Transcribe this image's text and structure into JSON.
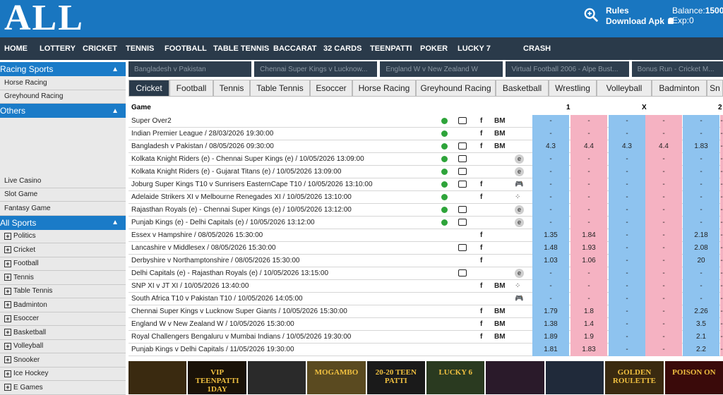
{
  "header": {
    "logo": "ALL",
    "rules": "Rules",
    "download": "Download Apk",
    "balance_label": "Balance:",
    "balance_value": "1500",
    "exp_label": "Exp:",
    "exp_value": "0"
  },
  "nav": [
    "HOME",
    "LOTTERY",
    "CRICKET",
    "TENNIS",
    "FOOTBALL",
    "TABLE TENNIS",
    "BACCARAT",
    "32 CARDS",
    "TEENPATTI",
    "POKER",
    "LUCKY 7",
    "CRASH"
  ],
  "sidebar": {
    "racing_title": "Racing Sports",
    "racing_items": [
      "Horse Racing",
      "Greyhound Racing"
    ],
    "others_title": "Others",
    "others_items": [
      "Live Casino",
      "Slot Game",
      "Fantasy Game"
    ],
    "all_title": "All Sports",
    "all_items": [
      "Politics",
      "Cricket",
      "Football",
      "Tennis",
      "Table Tennis",
      "Badminton",
      "Esoccer",
      "Basketball",
      "Volleyball",
      "Snooker",
      "Ice Hockey",
      "E Games"
    ]
  },
  "tickers": [
    "Bangladesh v Pakistan",
    "Chennai Super Kings v Lucknow...",
    "England W v New Zealand W",
    "Virtual Football 2006 - Alpe Bust...",
    "Bonus Run - Cricket M..."
  ],
  "tabs": [
    "Cricket",
    "Football",
    "Tennis",
    "Table Tennis",
    "Esoccer",
    "Horse Racing",
    "Greyhound Racing",
    "Basketball",
    "Wrestling",
    "Volleyball",
    "Badminton",
    "Sn"
  ],
  "table": {
    "col_game": "Game",
    "col_1": "1",
    "col_x": "X",
    "col_2": "2",
    "rows": [
      {
        "name": "Super Over2",
        "live": true,
        "tv": true,
        "f": true,
        "bm": true,
        "e": false,
        "icon": "",
        "odds": [
          "-",
          "-",
          "-",
          "-",
          "-",
          "-"
        ]
      },
      {
        "name": "Indian Premier League / 28/03/2026 19:30:00",
        "live": true,
        "tv": false,
        "f": true,
        "bm": true,
        "e": false,
        "icon": "",
        "odds": [
          "-",
          "-",
          "-",
          "-",
          "-",
          "-"
        ]
      },
      {
        "name": "Bangladesh v Pakistan / 08/05/2026 09:30:00",
        "live": true,
        "tv": true,
        "f": true,
        "bm": true,
        "e": false,
        "icon": "",
        "odds": [
          "4.3",
          "4.4",
          "4.3",
          "4.4",
          "1.83",
          "-"
        ]
      },
      {
        "name": "Kolkata Knight Riders (e) - Chennai Super Kings (e) / 10/05/2026 13:09:00",
        "live": true,
        "tv": true,
        "f": false,
        "bm": false,
        "e": true,
        "icon": "",
        "odds": [
          "-",
          "-",
          "-",
          "-",
          "-",
          "-"
        ]
      },
      {
        "name": "Kolkata Knight Riders (e) - Gujarat Titans (e) / 10/05/2026 13:09:00",
        "live": true,
        "tv": true,
        "f": false,
        "bm": false,
        "e": true,
        "icon": "",
        "odds": [
          "-",
          "-",
          "-",
          "-",
          "-",
          "-"
        ]
      },
      {
        "name": "Joburg Super Kings T10 v Sunrisers EasternCape T10 / 10/05/2026 13:10:00",
        "live": true,
        "tv": true,
        "f": true,
        "bm": false,
        "e": false,
        "icon": "gamepad",
        "odds": [
          "-",
          "-",
          "-",
          "-",
          "-",
          "-"
        ]
      },
      {
        "name": "Adelaide Strikers XI v Melbourne Renegades XI / 10/05/2026 13:10:00",
        "live": true,
        "tv": false,
        "f": true,
        "bm": false,
        "e": false,
        "icon": "dice",
        "odds": [
          "-",
          "-",
          "-",
          "-",
          "-",
          "-"
        ]
      },
      {
        "name": "Rajasthan Royals (e) - Chennai Super Kings (e) / 10/05/2026 13:12:00",
        "live": true,
        "tv": true,
        "f": false,
        "bm": false,
        "e": true,
        "icon": "",
        "odds": [
          "-",
          "-",
          "-",
          "-",
          "-",
          "-"
        ]
      },
      {
        "name": "Punjab Kings (e) - Delhi Capitals (e) / 10/05/2026 13:12:00",
        "live": true,
        "tv": true,
        "f": false,
        "bm": false,
        "e": true,
        "icon": "",
        "odds": [
          "-",
          "-",
          "-",
          "-",
          "-",
          "-"
        ]
      },
      {
        "name": "Essex v Hampshire / 08/05/2026 15:30:00",
        "live": false,
        "tv": false,
        "f": true,
        "bm": false,
        "e": false,
        "icon": "",
        "odds": [
          "1.35",
          "1.84",
          "-",
          "-",
          "2.18",
          "-"
        ]
      },
      {
        "name": "Lancashire v Middlesex / 08/05/2026 15:30:00",
        "live": false,
        "tv": true,
        "f": true,
        "bm": false,
        "e": false,
        "icon": "",
        "odds": [
          "1.48",
          "1.93",
          "-",
          "-",
          "2.08",
          "-"
        ]
      },
      {
        "name": "Derbyshire v Northamptonshire / 08/05/2026 15:30:00",
        "live": false,
        "tv": false,
        "f": true,
        "bm": false,
        "e": false,
        "icon": "",
        "odds": [
          "1.03",
          "1.06",
          "-",
          "-",
          "20",
          "-"
        ]
      },
      {
        "name": "Delhi Capitals (e) - Rajasthan Royals (e) / 10/05/2026 13:15:00",
        "live": false,
        "tv": true,
        "f": false,
        "bm": false,
        "e": true,
        "icon": "",
        "odds": [
          "-",
          "-",
          "-",
          "-",
          "-",
          "-"
        ]
      },
      {
        "name": "SNP XI v JT XI / 10/05/2026 13:40:00",
        "live": false,
        "tv": false,
        "f": true,
        "bm": true,
        "e": false,
        "icon": "dice",
        "odds": [
          "-",
          "-",
          "-",
          "-",
          "-",
          "-"
        ]
      },
      {
        "name": "South Africa T10 v Pakistan T10 / 10/05/2026 14:05:00",
        "live": false,
        "tv": false,
        "f": false,
        "bm": false,
        "e": false,
        "icon": "gamepad",
        "odds": [
          "-",
          "-",
          "-",
          "-",
          "-",
          "-"
        ]
      },
      {
        "name": "Chennai Super Kings v Lucknow Super Giants / 10/05/2026 15:30:00",
        "live": false,
        "tv": false,
        "f": true,
        "bm": true,
        "e": false,
        "icon": "",
        "odds": [
          "1.79",
          "1.8",
          "-",
          "-",
          "2.26",
          "-"
        ]
      },
      {
        "name": "England W v New Zealand W / 10/05/2026 15:30:00",
        "live": false,
        "tv": false,
        "f": true,
        "bm": true,
        "e": false,
        "icon": "",
        "odds": [
          "1.38",
          "1.4",
          "-",
          "-",
          "3.5",
          "-"
        ]
      },
      {
        "name": "Royal Challengers Bengaluru v Mumbai Indians / 10/05/2026 19:30:00",
        "live": false,
        "tv": false,
        "f": true,
        "bm": true,
        "e": false,
        "icon": "",
        "odds": [
          "1.89",
          "1.9",
          "-",
          "-",
          "2.1",
          "-"
        ]
      },
      {
        "name": "Punjab Kings v Delhi Capitals / 11/05/2026 19:30:00",
        "live": false,
        "tv": false,
        "f": false,
        "bm": false,
        "e": false,
        "icon": "",
        "odds": [
          "1.81",
          "1.83",
          "-",
          "-",
          "2.2",
          "-"
        ]
      }
    ]
  },
  "games": [
    {
      "label": "",
      "bg": "#3a2a10"
    },
    {
      "label": "VIP TEENPATTI 1DAY",
      "bg": "#1a1208"
    },
    {
      "label": "",
      "bg": "#2a2a2a"
    },
    {
      "label": "MOGAMBO",
      "bg": "#5a4a20"
    },
    {
      "label": "20-20 TEEN PATTI",
      "bg": "#1a1a1a"
    },
    {
      "label": "LUCKY 6",
      "bg": "#2a3a20"
    },
    {
      "label": "",
      "bg": "#2a1a2a"
    },
    {
      "label": "",
      "bg": "#202a3a"
    },
    {
      "label": "GOLDEN ROULETTE",
      "bg": "#3a2a10"
    },
    {
      "label": "POISON ON",
      "bg": "#3a0a0a"
    }
  ],
  "colors": {
    "header": "#1976c0",
    "nav": "#2a3a4a",
    "back": "#8ec3ef",
    "lay": "#f5b2c2",
    "live": "#2ea43a"
  }
}
